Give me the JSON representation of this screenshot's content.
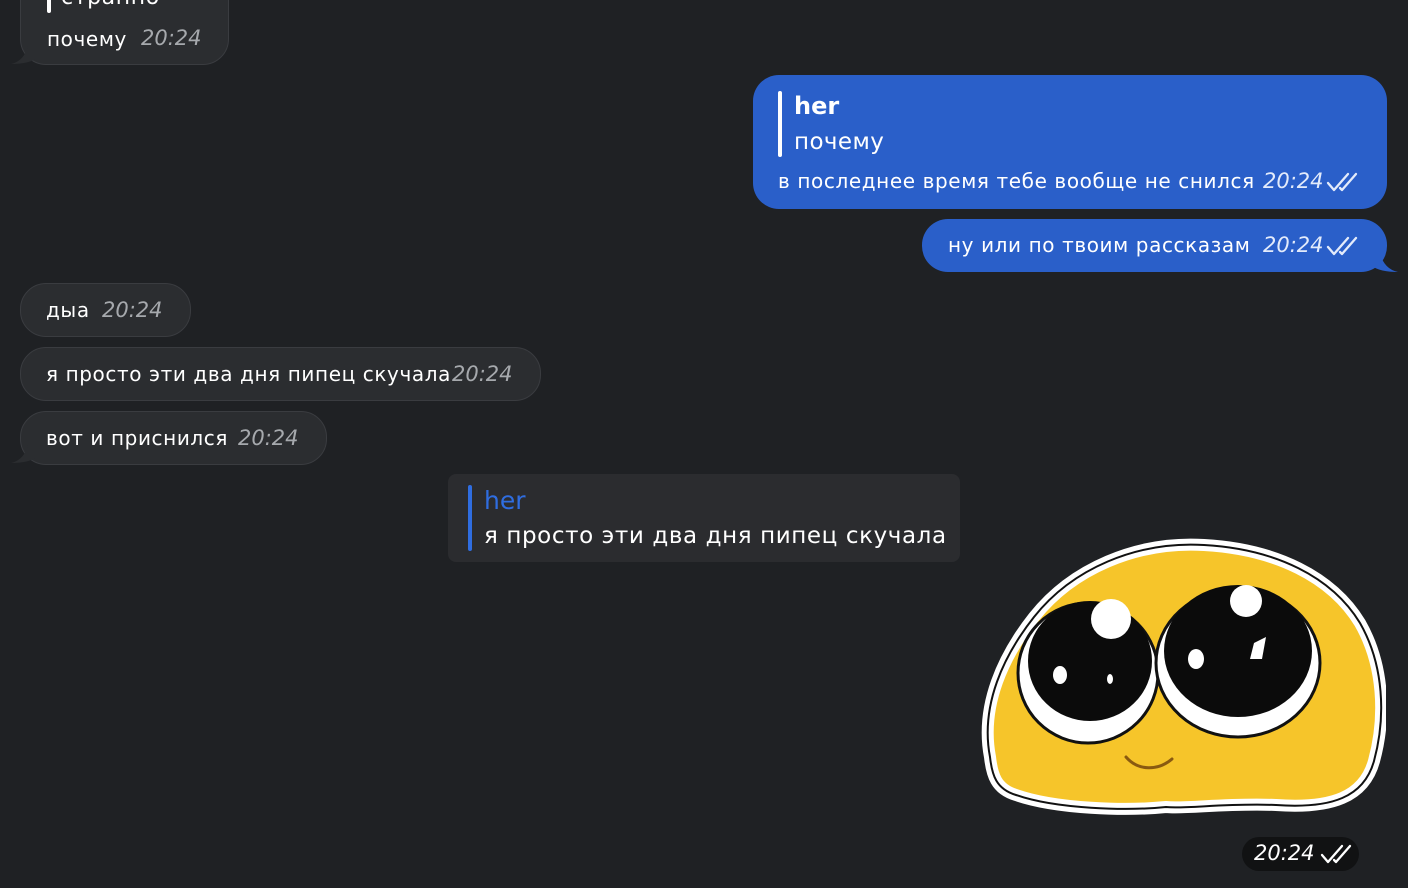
{
  "colors": {
    "background": "#1f2124",
    "incoming_bubble": "#2b2d30",
    "outgoing_bubble": "#2a5fc9",
    "reply_accent": "#2f6de0",
    "sticker_yellow": "#f6c52a"
  },
  "messages": [
    {
      "quote_text": "странно",
      "text": "почему",
      "time": "20:24"
    },
    {
      "quote_name": "her",
      "quote_text": "почему",
      "text": "в последнее время тебе вообще не снился",
      "time": "20:24"
    },
    {
      "text": "ну или по твоим рассказам",
      "time": "20:24"
    },
    {
      "text": "дыа",
      "time": "20:24"
    },
    {
      "text": "я просто эти два дня пипец скучала",
      "time": "20:24"
    },
    {
      "text": "вот и приснился",
      "time": "20:24"
    }
  ],
  "reply_preview": {
    "name": "her",
    "text": "я просто эти два дня пипец скучала"
  },
  "sticker": {
    "icon": "pleading-face-sticker-icon",
    "time": "20:24"
  }
}
